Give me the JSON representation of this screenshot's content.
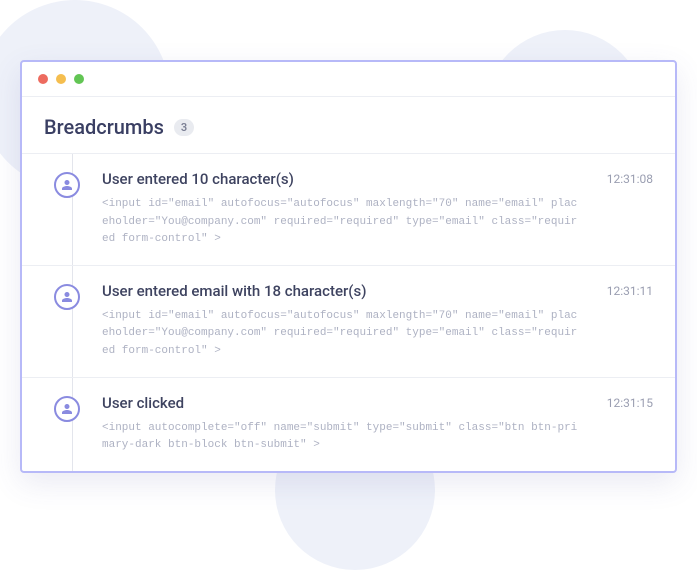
{
  "header": {
    "title": "Breadcrumbs",
    "badge": "3"
  },
  "entries": [
    {
      "title": "User entered 10 character(s)",
      "code": "<input id=\"email\" autofocus=\"autofocus\" maxlength=\"70\" name=\"email\" placeholder=\"You@company.com\" required=\"required\" type=\"email\" class=\"required form-control\" >",
      "time": "12:31:08"
    },
    {
      "title": "User entered email with 18 character(s)",
      "code": "<input id=\"email\" autofocus=\"autofocus\" maxlength=\"70\" name=\"email\" placeholder=\"You@company.com\" required=\"required\" type=\"email\" class=\"required form-control\" >",
      "time": "12:31:11"
    },
    {
      "title": "User clicked",
      "code": "<input autocomplete=\"off\" name=\"submit\" type=\"submit\" class=\"btn btn-primary-dark btn-block btn-submit\" >",
      "time": "12:31:15"
    }
  ]
}
